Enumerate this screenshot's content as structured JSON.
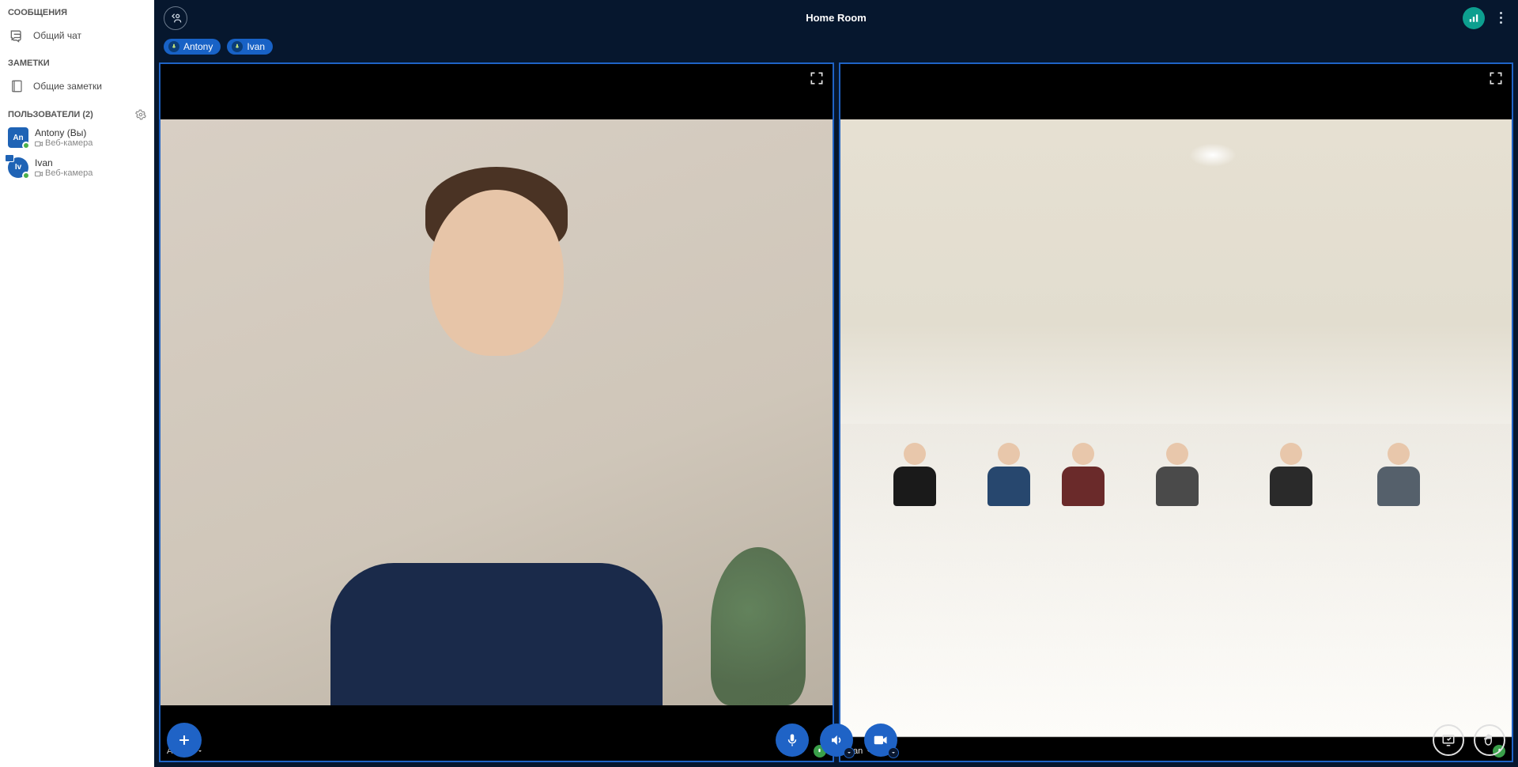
{
  "sidebar": {
    "messages_title": "СООБЩЕНИЯ",
    "public_chat": "Общий чат",
    "notes_title": "ЗАМЕТКИ",
    "shared_notes": "Общие заметки",
    "users_title": "ПОЛЬЗОВАТЕЛИ (2)",
    "users": [
      {
        "initials": "An",
        "name": "Antony (Вы)",
        "sub": "Веб-камера"
      },
      {
        "initials": "Iv",
        "name": "Ivan",
        "sub": "Веб-камера"
      }
    ]
  },
  "header": {
    "room_title": "Home Room"
  },
  "speakers": [
    {
      "name": "Antony"
    },
    {
      "name": "Ivan"
    }
  ],
  "tiles": [
    {
      "name": "Antony"
    },
    {
      "name": "Ivan"
    }
  ]
}
